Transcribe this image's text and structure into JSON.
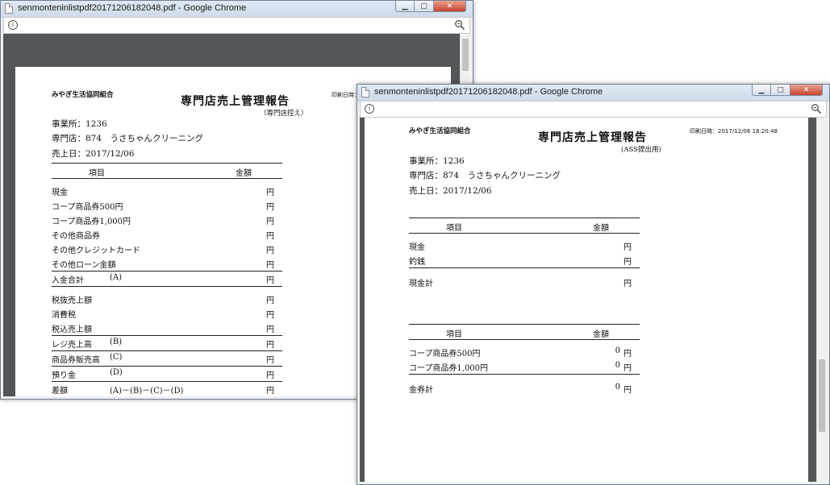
{
  "window1": {
    "title": "senmonteninlistpdf20171206182048.pdf - Google Chrome",
    "pdf": {
      "org": "みやぎ生活協同組合",
      "doc_title": "専門店売上管理報告",
      "copy_label": "（専門店控え）",
      "print_label": "印刷日時：",
      "office": "事業所：1236",
      "shop": "専門店：874　うさちゃんクリーニング",
      "sales_date": "売上日：2017/12/06",
      "col_item": "項目",
      "col_amount": "金額",
      "unit": "円",
      "rows": [
        {
          "label": "現金",
          "label2": ""
        },
        {
          "label": "コープ商品券500円",
          "label2": ""
        },
        {
          "label": "コープ商品券1,000円",
          "label2": ""
        },
        {
          "label": "その他商品券",
          "label2": ""
        },
        {
          "label": "その他クレジットカード",
          "label2": ""
        },
        {
          "label": "その他ローン金額",
          "label2": ""
        },
        {
          "label": "入金合計",
          "label2": "(A)"
        },
        {
          "label": "税抜売上額",
          "label2": ""
        },
        {
          "label": "消費税",
          "label2": ""
        },
        {
          "label": "税込売上額",
          "label2": ""
        },
        {
          "label": "レジ売上高",
          "label2": "(B)"
        },
        {
          "label": "商品券販売高",
          "label2": "(C)"
        },
        {
          "label": "預り金",
          "label2": "(D)"
        },
        {
          "label": "差額",
          "label2": "(A)－(B)－(C)－(D)"
        }
      ]
    }
  },
  "window2": {
    "title": "senmonteninlistpdf20171206182048.pdf - Google Chrome",
    "pdf": {
      "org": "みやぎ生活協同組合",
      "doc_title": "専門店売上管理報告",
      "copy_label": "(ASS提出用)",
      "print_datetime": "印刷日時：2017/12/06 18:20:48",
      "office": "事業所：1236",
      "shop": "専門店：874　うさちゃんクリーニング",
      "sales_date": "売上日：2017/12/06",
      "col_item": "項目",
      "col_amount": "金額",
      "unit": "円",
      "cash_rows": [
        {
          "label": "現金",
          "amount": ""
        },
        {
          "label": "釣銭",
          "amount": ""
        }
      ],
      "cash_total": {
        "label": "現金計",
        "amount": ""
      },
      "voucher_rows": [
        {
          "label": "コープ商品券500円",
          "amount": "0"
        },
        {
          "label": "コープ商品券1,000円",
          "amount": "0"
        }
      ],
      "voucher_total": {
        "label": "金券計",
        "amount": "0"
      }
    }
  },
  "icons": {
    "info": "info-icon",
    "zoom": "zoom-icon",
    "page": "page-icon",
    "minimize": "minimize-icon",
    "maximize": "maximize-icon",
    "close": "close-icon"
  }
}
